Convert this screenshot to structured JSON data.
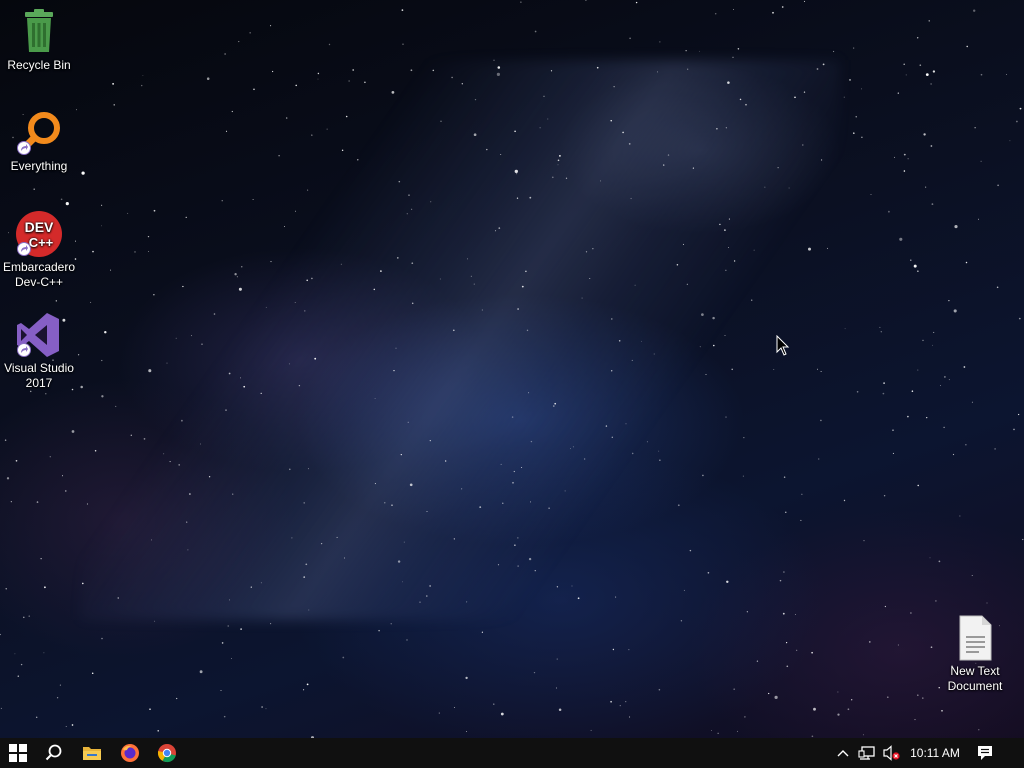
{
  "desktop": {
    "icons": [
      {
        "label_line1": "Recycle Bin",
        "label_line2": "",
        "icon": "recycle-bin-icon"
      },
      {
        "label_line1": "Everything",
        "label_line2": "",
        "icon": "everything-search-icon"
      },
      {
        "label_line1": "Embarcadero",
        "label_line2": "Dev-C++",
        "icon": "dev-cpp-icon",
        "icon_text_top": "DEV",
        "icon_text_bottom": "C++"
      },
      {
        "label_line1": "Visual Studio",
        "label_line2": "2017",
        "icon": "visual-studio-icon"
      },
      {
        "label_line1": "New Text",
        "label_line2": "Document",
        "icon": "text-document-icon"
      }
    ]
  },
  "taskbar": {
    "apps": [
      {
        "name": "Start",
        "icon": "windows-start-icon"
      },
      {
        "name": "Search",
        "icon": "search-icon"
      },
      {
        "name": "File Explorer",
        "icon": "file-explorer-icon"
      },
      {
        "name": "Firefox",
        "icon": "firefox-icon"
      },
      {
        "name": "Chrome",
        "icon": "chrome-icon"
      }
    ],
    "tray": {
      "show_hidden": "chevron-up-icon",
      "network": "network-icon",
      "volume": "volume-muted-icon",
      "clock": "10:11 AM",
      "notifications": "action-center-icon"
    }
  },
  "colors": {
    "taskbar_bg": "#101010",
    "recycle_green": "#4a9a4a",
    "everything_orange": "#f28a1c",
    "devcpp_red": "#d42a2a",
    "vs_purple": "#865fc5"
  }
}
